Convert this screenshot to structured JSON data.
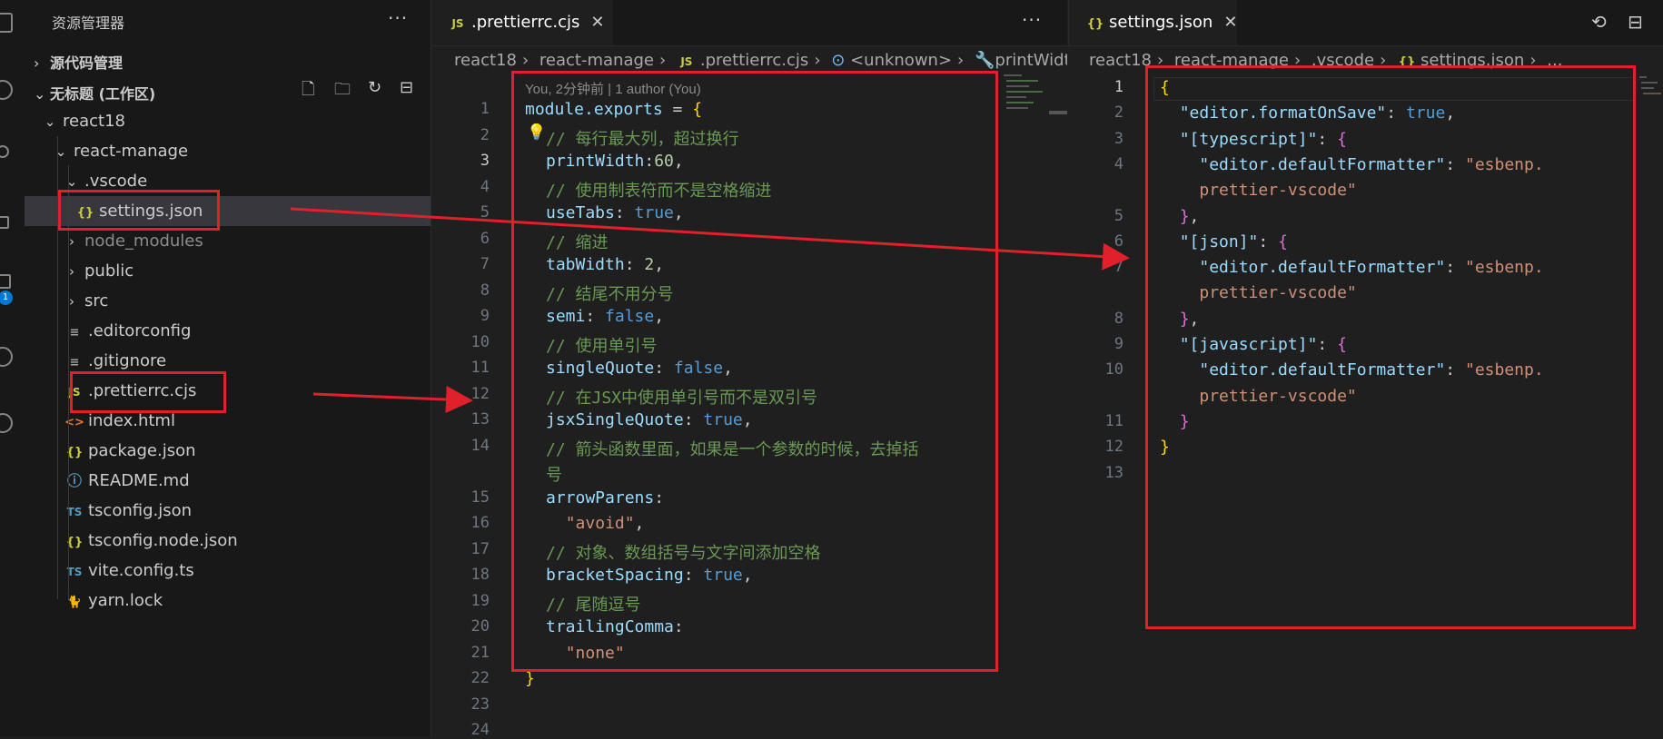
{
  "activity_bar": {
    "badge": "1",
    "icons": [
      "explorer-icon",
      "search-icon",
      "source-control-icon",
      "run-debug-icon",
      "extensions-icon",
      "remote-icon",
      "accounts-icon"
    ]
  },
  "sidebar": {
    "title": "资源管理器",
    "more": "···",
    "source_control_section": "源代码管理",
    "workspace_section": "无标题 (工作区)",
    "tree": [
      {
        "label": "react18",
        "depth": 0,
        "type": "folder",
        "open": true
      },
      {
        "label": "react-manage",
        "depth": 1,
        "type": "folder",
        "open": true
      },
      {
        "label": ".vscode",
        "depth": 2,
        "type": "folder",
        "open": true
      },
      {
        "label": "settings.json",
        "depth": 3,
        "type": "json",
        "selected": true
      },
      {
        "label": "node_modules",
        "depth": 2,
        "type": "folder",
        "open": false,
        "dim": true
      },
      {
        "label": "public",
        "depth": 2,
        "type": "folder",
        "open": false
      },
      {
        "label": "src",
        "depth": 2,
        "type": "folder",
        "open": false
      },
      {
        "label": ".editorconfig",
        "depth": 2,
        "type": "txt"
      },
      {
        "label": ".gitignore",
        "depth": 2,
        "type": "txt"
      },
      {
        "label": ".prettierrc.cjs",
        "depth": 2,
        "type": "js"
      },
      {
        "label": "index.html",
        "depth": 2,
        "type": "html"
      },
      {
        "label": "package.json",
        "depth": 2,
        "type": "json"
      },
      {
        "label": "README.md",
        "depth": 2,
        "type": "info"
      },
      {
        "label": "tsconfig.json",
        "depth": 2,
        "type": "tsconfig"
      },
      {
        "label": "tsconfig.node.json",
        "depth": 2,
        "type": "json"
      },
      {
        "label": "vite.config.ts",
        "depth": 2,
        "type": "ts"
      },
      {
        "label": "yarn.lock",
        "depth": 2,
        "type": "yarn"
      }
    ]
  },
  "left_editor": {
    "tab_label": ".prettierrc.cjs",
    "tab_icon": "JS",
    "more": "···",
    "breadcrumb": [
      "react18",
      "react-manage",
      ".prettierrc.cjs",
      "<unknown>",
      "printWidth"
    ],
    "blame": "You, 2分钟前 | 1 author (You)",
    "line_numbers": [
      "1",
      "2",
      "3",
      "4",
      "5",
      "6",
      "7",
      "8",
      "9",
      "10",
      "11",
      "12",
      "13",
      "14",
      "",
      "15",
      "16",
      "17",
      "18",
      "19",
      "20",
      "21",
      "22",
      "23",
      "24"
    ],
    "current_line": "3",
    "lines": [
      [
        {
          "t": "module.exports",
          "c": "k"
        },
        {
          "t": " = ",
          "c": "pn"
        },
        {
          "t": "{",
          "c": "br"
        }
      ],
      [
        {
          "t": "// 每行最大列，超过换行",
          "c": "cm"
        }
      ],
      [
        {
          "t": "printWidth",
          "c": "k"
        },
        {
          "t": ":",
          "c": "pn"
        },
        {
          "t": "60",
          "c": "n"
        },
        {
          "t": ",",
          "c": "pn"
        }
      ],
      [
        {
          "t": "// 使用制表符而不是空格缩进",
          "c": "cm"
        }
      ],
      [
        {
          "t": "useTabs",
          "c": "k"
        },
        {
          "t": ": ",
          "c": "pn"
        },
        {
          "t": "true",
          "c": "b"
        },
        {
          "t": ",",
          "c": "pn"
        }
      ],
      [
        {
          "t": "// 缩进",
          "c": "cm"
        }
      ],
      [
        {
          "t": "tabWidth",
          "c": "k"
        },
        {
          "t": ": ",
          "c": "pn"
        },
        {
          "t": "2",
          "c": "n"
        },
        {
          "t": ",",
          "c": "pn"
        }
      ],
      [
        {
          "t": "// 结尾不用分号",
          "c": "cm"
        }
      ],
      [
        {
          "t": "semi",
          "c": "k"
        },
        {
          "t": ": ",
          "c": "pn"
        },
        {
          "t": "false",
          "c": "b"
        },
        {
          "t": ",",
          "c": "pn"
        }
      ],
      [
        {
          "t": "// 使用单引号",
          "c": "cm"
        }
      ],
      [
        {
          "t": "singleQuote",
          "c": "k"
        },
        {
          "t": ": ",
          "c": "pn"
        },
        {
          "t": "false",
          "c": "b"
        },
        {
          "t": ",",
          "c": "pn"
        }
      ],
      [
        {
          "t": "// 在JSX中使用单引号而不是双引号",
          "c": "cm"
        }
      ],
      [
        {
          "t": "jsxSingleQuote",
          "c": "k"
        },
        {
          "t": ": ",
          "c": "pn"
        },
        {
          "t": "true",
          "c": "b"
        },
        {
          "t": ",",
          "c": "pn"
        }
      ],
      [
        {
          "t": "// 箭头函数里面，如果是一个参数的时候，去掉括",
          "c": "cm"
        }
      ],
      [
        {
          "t": "号",
          "c": "cm"
        }
      ],
      [
        {
          "t": "arrowParens",
          "c": "k"
        },
        {
          "t": ":",
          "c": "pn"
        }
      ],
      [
        {
          "t": "  ",
          "c": "pn"
        },
        {
          "t": "\"avoid\"",
          "c": "s"
        },
        {
          "t": ",",
          "c": "pn"
        }
      ],
      [
        {
          "t": "// 对象、数组括号与文字间添加空格",
          "c": "cm"
        }
      ],
      [
        {
          "t": "bracketSpacing",
          "c": "k"
        },
        {
          "t": ": ",
          "c": "pn"
        },
        {
          "t": "true",
          "c": "b"
        },
        {
          "t": ",",
          "c": "pn"
        }
      ],
      [
        {
          "t": "// 尾随逗号",
          "c": "cm"
        }
      ],
      [
        {
          "t": "trailingComma",
          "c": "k"
        },
        {
          "t": ":",
          "c": "pn"
        }
      ],
      [
        {
          "t": "  ",
          "c": "pn"
        },
        {
          "t": "\"none\"",
          "c": "s"
        }
      ],
      [
        {
          "t": "}",
          "c": "br"
        }
      ],
      [],
      []
    ]
  },
  "right_editor": {
    "tab_label": "settings.json",
    "tab_icon": "{}",
    "close": "✕",
    "breadcrumb": [
      "react18",
      "react-manage",
      ".vscode",
      "settings.json",
      "..."
    ],
    "line_numbers": [
      "1",
      "2",
      "3",
      "4",
      "",
      "5",
      "6",
      "7",
      "",
      "8",
      "9",
      "10",
      "",
      "11",
      "12",
      "13"
    ],
    "current_line": "1",
    "lines": [
      [
        {
          "t": "{",
          "c": "br"
        }
      ],
      [
        {
          "t": "  ",
          "c": "pn"
        },
        {
          "t": "\"editor.formatOnSave\"",
          "c": "k"
        },
        {
          "t": ": ",
          "c": "pn"
        },
        {
          "t": "true",
          "c": "b"
        },
        {
          "t": ",",
          "c": "pn"
        }
      ],
      [
        {
          "t": "  ",
          "c": "pn"
        },
        {
          "t": "\"[typescript]\"",
          "c": "k"
        },
        {
          "t": ": ",
          "c": "pn"
        },
        {
          "t": "{",
          "c": "br2"
        }
      ],
      [
        {
          "t": "    ",
          "c": "pn"
        },
        {
          "t": "\"editor.defaultFormatter\"",
          "c": "k"
        },
        {
          "t": ": ",
          "c": "pn"
        },
        {
          "t": "\"esbenp.",
          "c": "s"
        }
      ],
      [
        {
          "t": "    ",
          "c": "pn"
        },
        {
          "t": "prettier-vscode\"",
          "c": "s"
        }
      ],
      [
        {
          "t": "  ",
          "c": "pn"
        },
        {
          "t": "}",
          "c": "br2"
        },
        {
          "t": ",",
          "c": "pn"
        }
      ],
      [
        {
          "t": "  ",
          "c": "pn"
        },
        {
          "t": "\"[json]\"",
          "c": "k"
        },
        {
          "t": ": ",
          "c": "pn"
        },
        {
          "t": "{",
          "c": "br2"
        }
      ],
      [
        {
          "t": "    ",
          "c": "pn"
        },
        {
          "t": "\"editor.defaultFormatter\"",
          "c": "k"
        },
        {
          "t": ": ",
          "c": "pn"
        },
        {
          "t": "\"esbenp.",
          "c": "s"
        }
      ],
      [
        {
          "t": "    ",
          "c": "pn"
        },
        {
          "t": "prettier-vscode\"",
          "c": "s"
        }
      ],
      [
        {
          "t": "  ",
          "c": "pn"
        },
        {
          "t": "}",
          "c": "br2"
        },
        {
          "t": ",",
          "c": "pn"
        }
      ],
      [
        {
          "t": "  ",
          "c": "pn"
        },
        {
          "t": "\"[javascript]\"",
          "c": "k"
        },
        {
          "t": ": ",
          "c": "pn"
        },
        {
          "t": "{",
          "c": "br2"
        }
      ],
      [
        {
          "t": "    ",
          "c": "pn"
        },
        {
          "t": "\"editor.defaultFormatter\"",
          "c": "k"
        },
        {
          "t": ": ",
          "c": "pn"
        },
        {
          "t": "\"esbenp.",
          "c": "s"
        }
      ],
      [
        {
          "t": "    ",
          "c": "pn"
        },
        {
          "t": "prettier-vscode\"",
          "c": "s"
        }
      ],
      [
        {
          "t": "  ",
          "c": "pn"
        },
        {
          "t": "}",
          "c": "br2"
        }
      ],
      [
        {
          "t": "}",
          "c": "br"
        }
      ],
      []
    ]
  },
  "colors": {
    "annotation": "#e0202a",
    "selection": "#37373d"
  }
}
